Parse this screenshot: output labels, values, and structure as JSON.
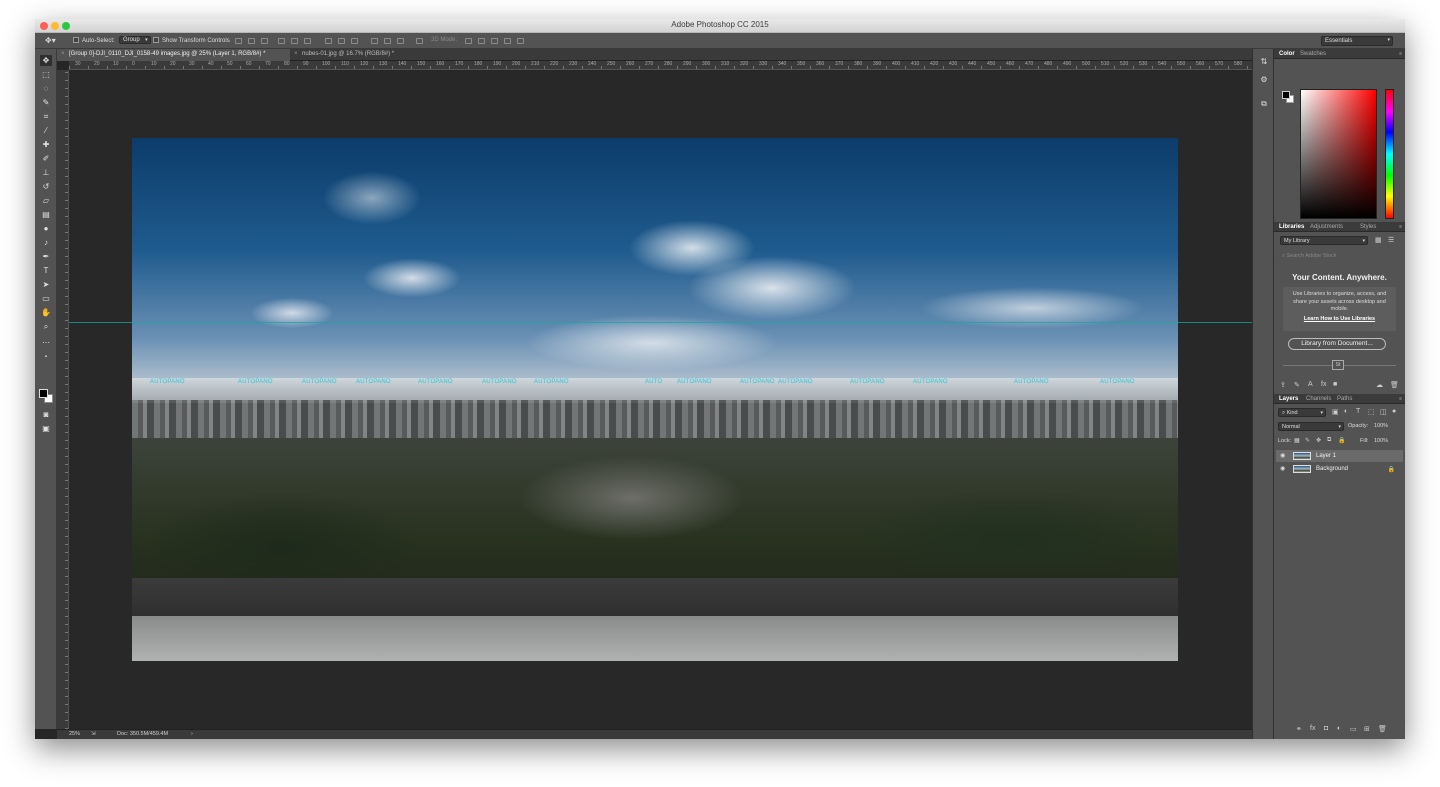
{
  "window": {
    "title": "Adobe Photoshop CC 2015"
  },
  "options_bar": {
    "auto_select_label": "Auto-Select:",
    "auto_select_value": "Group",
    "transform_label": "Show Transform Controls",
    "mode_3d_label": "3D Mode:",
    "workspace": "Essentials"
  },
  "tabs": [
    {
      "label": "[Group 0]-DJI_0110_DJI_0158-49 images.jpg @ 25% (Layer 1, RGB/8#) *",
      "active": true
    },
    {
      "label": "nubes-01.jpg @ 16.7% (RGB/8#) *",
      "active": false
    }
  ],
  "ruler_ticks": [
    "30",
    "20",
    "10",
    "0",
    "10",
    "20",
    "30",
    "40",
    "50",
    "60",
    "70",
    "80",
    "90",
    "100",
    "110",
    "120",
    "130",
    "140",
    "150",
    "160",
    "170",
    "180",
    "190",
    "200",
    "210",
    "220",
    "230",
    "240",
    "250",
    "260",
    "270",
    "280",
    "290",
    "300",
    "310",
    "320",
    "330",
    "340",
    "350",
    "360",
    "370",
    "380",
    "390",
    "400",
    "410",
    "420",
    "430",
    "440",
    "450",
    "460",
    "470",
    "480",
    "490",
    "500",
    "510",
    "520",
    "530",
    "540",
    "550",
    "560",
    "570",
    "580"
  ],
  "canvas": {
    "watermarks": [
      "AUTOPANO",
      "AUTOPANO",
      "AUTOPANO",
      "AUTOPANO",
      "AUTOPANO",
      "AUTOPANO",
      "AUTOPANO",
      "AUTO",
      "AUTOPANO",
      "AUTOPANO",
      "AUTOPANO",
      "AUTOPANO",
      "AUTOPANO",
      "AUTOPANO",
      "AUTOPANO"
    ]
  },
  "status": {
    "zoom": "25%",
    "doc": "Doc: 350.5M/459.4M"
  },
  "color_panel": {
    "tabs": [
      "Color",
      "Swatches"
    ]
  },
  "libraries_panel": {
    "tabs": [
      "Libraries",
      "Adjustments",
      "Styles"
    ],
    "library_select": "My Library",
    "search_placeholder": "Search Adobe Stock",
    "headline": "Your Content. Anywhere.",
    "description": "Use Libraries to organize, access, and share your assets across desktop and mobile.",
    "link": "Learn How to Use Libraries",
    "button": "Library from Document...",
    "badge": "St"
  },
  "layers_panel": {
    "tabs": [
      "Layers",
      "Channels",
      "Paths"
    ],
    "filter": "Kind",
    "blend_mode": "Normal",
    "opacity_label": "Opacity:",
    "opacity_value": "100%",
    "lock_label": "Lock:",
    "fill_label": "Fill:",
    "fill_value": "100%",
    "layers": [
      {
        "name": "Layer 1",
        "selected": true
      },
      {
        "name": "Background",
        "selected": false
      }
    ]
  }
}
